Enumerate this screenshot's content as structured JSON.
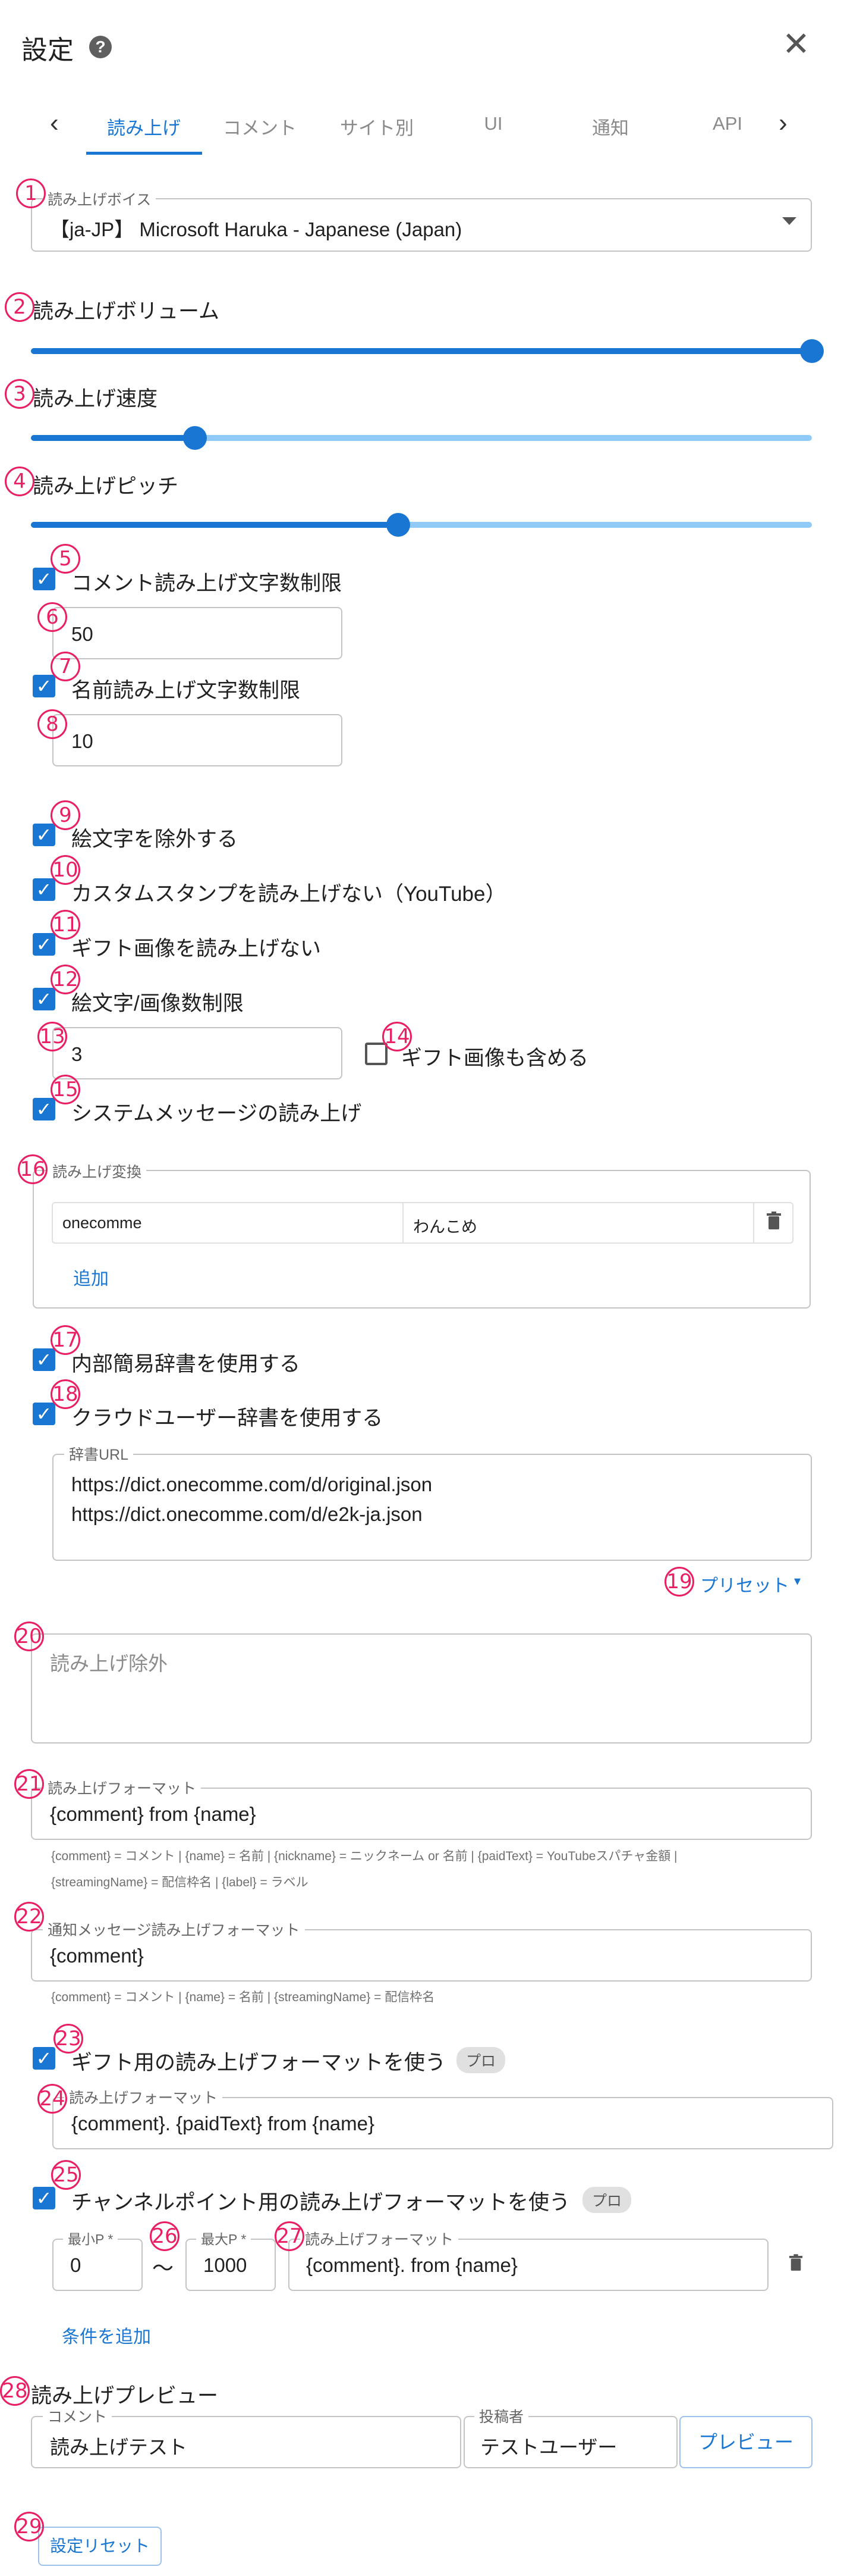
{
  "header": {
    "title": "設定",
    "help_icon": "?",
    "close_icon": "✕"
  },
  "tabs": [
    {
      "label": "読み上げ"
    },
    {
      "label": "コメント"
    },
    {
      "label": "サイト別"
    },
    {
      "label": "UI"
    },
    {
      "label": "通知"
    },
    {
      "label": "API"
    }
  ],
  "nav": {
    "prev": "‹",
    "next": "›"
  },
  "markers": [
    "1",
    "2",
    "3",
    "4",
    "5",
    "6",
    "7",
    "8",
    "9",
    "10",
    "11",
    "12",
    "13",
    "14",
    "15",
    "16",
    "17",
    "18",
    "19",
    "20",
    "21",
    "22",
    "23",
    "24",
    "25",
    "26",
    "27",
    "28",
    "29"
  ],
  "voice": {
    "label": "読み上げボイス",
    "value": "【ja-JP】 Microsoft Haruka - Japanese (Japan)"
  },
  "volume": {
    "label": "読み上げボリューム",
    "level": 1.0
  },
  "speed": {
    "label": "読み上げ速度",
    "level": 0.21
  },
  "pitch": {
    "label": "読み上げピッチ",
    "level": 0.47
  },
  "comment_limit": {
    "label": "コメント読み上げ文字数制限",
    "value": "50",
    "checked": true
  },
  "name_limit": {
    "label": "名前読み上げ文字数制限",
    "value": "10",
    "checked": true
  },
  "emoji_exclude": {
    "label": "絵文字を除外する",
    "checked": true
  },
  "custom_stamp": {
    "label": "カスタムスタンプを読み上げない（YouTube）",
    "checked": true
  },
  "gift_image": {
    "label": "ギフト画像を読み上げない",
    "checked": true
  },
  "emoji_image_limit": {
    "label": "絵文字/画像数制限",
    "value": "3",
    "checked": true
  },
  "include_gift": {
    "label": "ギフト画像も含める",
    "checked": false
  },
  "system_message": {
    "label": "システムメッセージの読み上げ",
    "checked": true
  },
  "conversion": {
    "label": "読み上げ変換",
    "rows": [
      {
        "from": "onecomme",
        "to": "わんこめ"
      }
    ],
    "add_label": "追加"
  },
  "internal_dict": {
    "label": "内部簡易辞書を使用する",
    "checked": true
  },
  "cloud_dict": {
    "label": "クラウドユーザー辞書を使用する",
    "checked": true,
    "url_label": "辞書URL",
    "urls": [
      "https://dict.onecomme.com/d/original.json",
      "https://dict.onecomme.com/d/e2k-ja.json"
    ]
  },
  "preset": {
    "label": "プリセット",
    "caret": "▾"
  },
  "exclude": {
    "placeholder": "読み上げ除外"
  },
  "format": {
    "label": "読み上げフォーマット",
    "value": "{comment} from {name}",
    "hint1": "{comment} = コメント | {name} = 名前 | {nickname} = ニックネーム or 名前 | {paidText} = YouTubeスパチャ金額 |",
    "hint2": "{streamingName} = 配信枠名 | {label} = ラベル"
  },
  "notify_format": {
    "label": "通知メッセージ読み上げフォーマット",
    "value": "{comment}",
    "hint": "{comment} = コメント | {name} = 名前 | {streamingName} = 配信枠名"
  },
  "gift_format": {
    "label": "ギフト用の読み上げフォーマットを使う",
    "pro": "プロ",
    "checked": true,
    "field_label": "読み上げフォーマット",
    "value": "{comment}. {paidText} from {name}"
  },
  "channel_point": {
    "label": "チャンネルポイント用の読み上げフォーマットを使う",
    "pro": "プロ",
    "checked": true,
    "min_label": "最小P *",
    "min_value": "0",
    "tilde": "〜",
    "max_label": "最大P *",
    "max_value": "1000",
    "format_label": "読み上げフォーマット",
    "format_value": "{comment}. from {name}",
    "add_condition": "条件を追加"
  },
  "preview": {
    "label": "読み上げプレビュー",
    "comment_label": "コメント",
    "comment_value": "読み上げテスト",
    "poster_label": "投稿者",
    "poster_value": "テストユーザー",
    "button": "プレビュー"
  },
  "reset": {
    "label": "設定リセット"
  },
  "colors": {
    "accent": "#1976d2",
    "marker": "#e91e63"
  }
}
